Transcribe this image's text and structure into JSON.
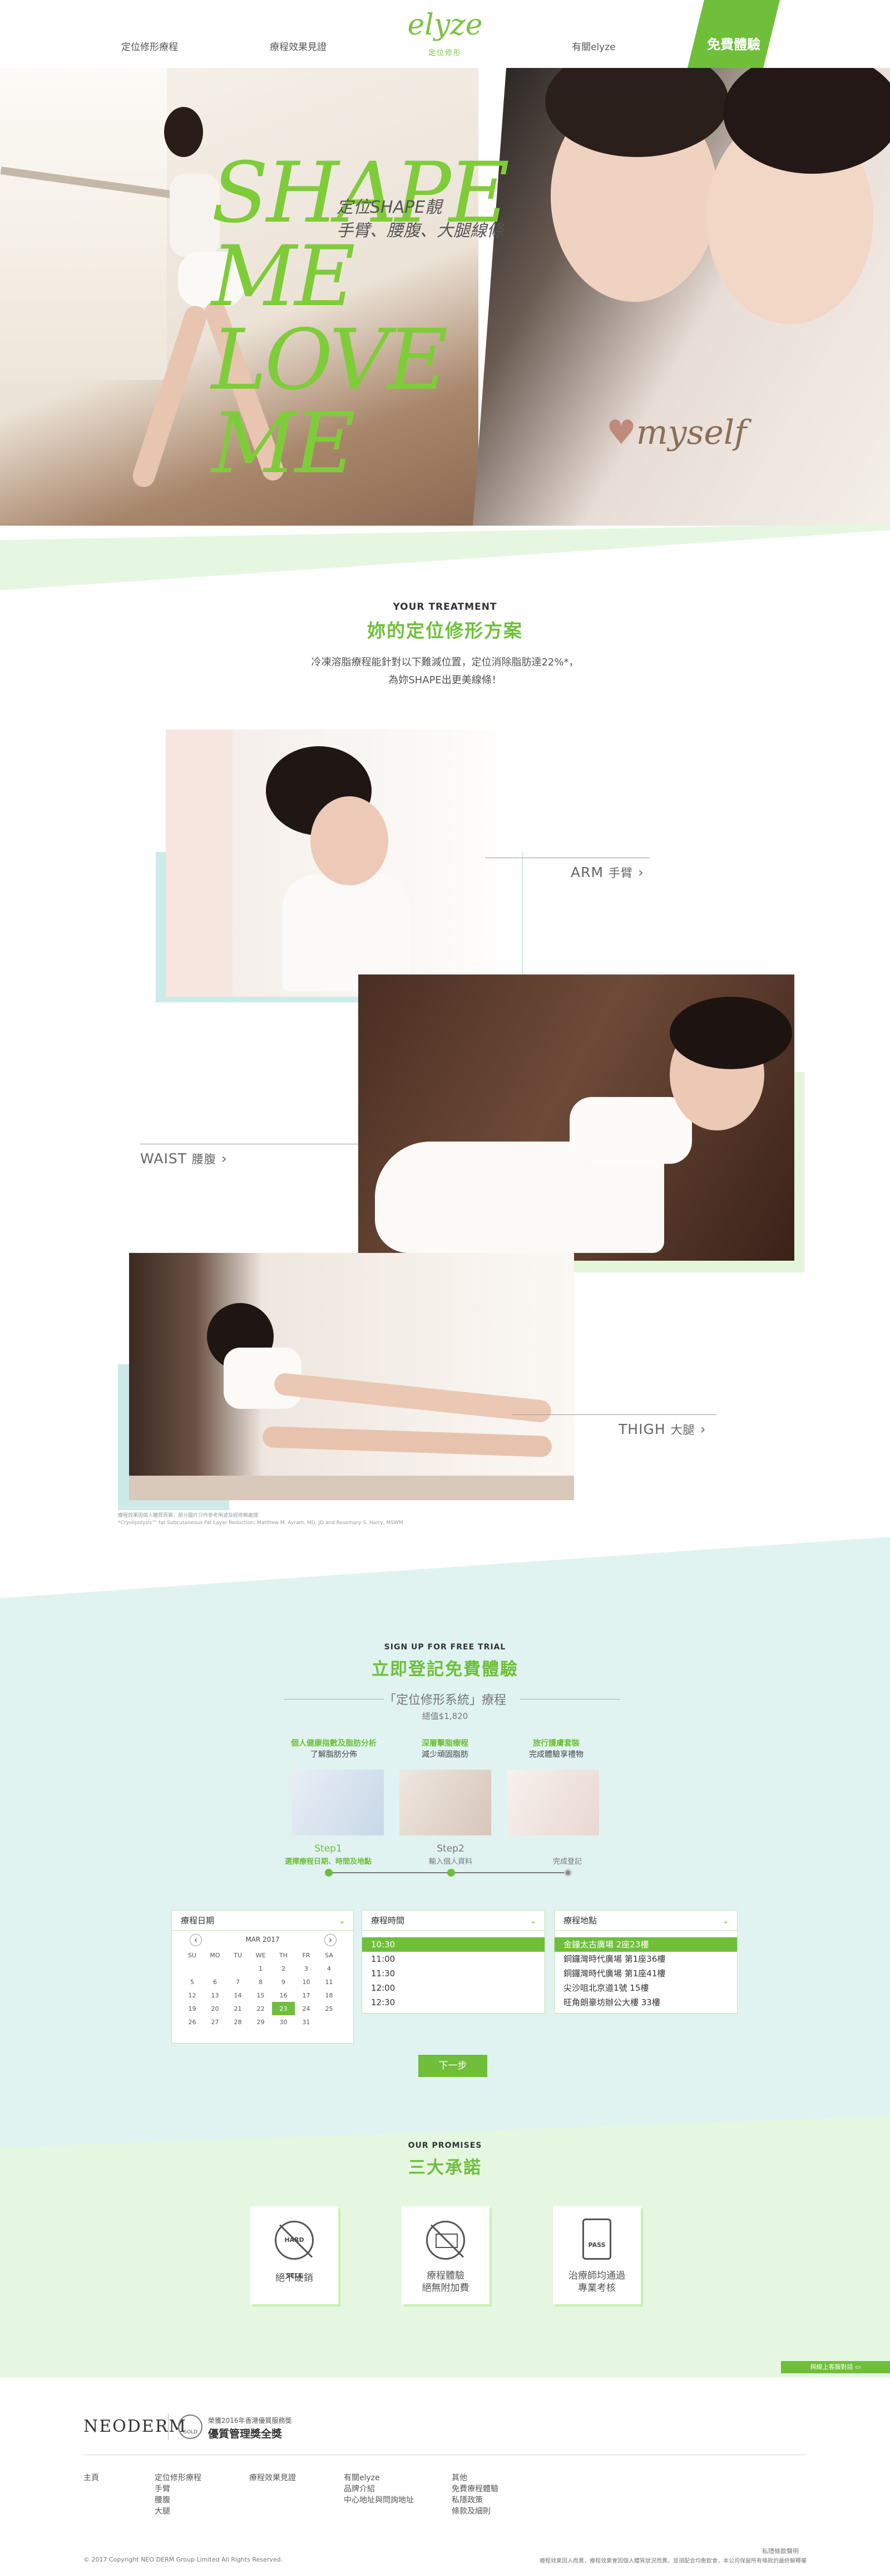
{
  "nav": {
    "item1": "定位修形療程",
    "item2": "療程效果見證",
    "item3": "有關elyze",
    "logo": "elyze",
    "logo_sub": "定位修形",
    "cta": "免費體驗"
  },
  "hero": {
    "headline": [
      "SHAPE",
      "ME",
      "LOVE",
      "ME"
    ],
    "sub1": "定位SHAPE靚",
    "sub2": "手臂、腰腹、大腿線條",
    "script": "myself"
  },
  "treatment": {
    "en": "YOUR TREATMENT",
    "zh": "妳的定位修形方案",
    "desc1": "冷凍溶脂療程能針對以下難減位置，定位消除脂肪達22%*，",
    "desc2": "為妳SHAPE出更美線條！",
    "areas": [
      {
        "en": "ARM",
        "zh": "手臂"
      },
      {
        "en": "WAIST",
        "zh": "腰腹"
      },
      {
        "en": "THIGH",
        "zh": "大腿"
      }
    ],
    "note1": "療程效果因個人體質而異，部分圖片只作參考用途及經修飾處理",
    "note2": "*Cryolipolysis™ fat Subcutaneous Fat Layer Reduction; Matthew M. Avram, MD,  JD and Rosemary S. Harry, MSWM"
  },
  "trial": {
    "en": "SIGN UP FOR FREE TRIAL",
    "zh": "立即登記免費體驗",
    "pkg": "「定位修形系統」療程",
    "price": "總值$1,820",
    "items": [
      {
        "t": "個人健康指數及脂肪分析",
        "s": "了解脂肪分佈"
      },
      {
        "t": "深層擊脂療程",
        "s": "減少頑固脂肪"
      },
      {
        "t": "旅行護膚套裝",
        "s": "完成體驗享禮物"
      }
    ],
    "steps": [
      {
        "n": "Step1",
        "t": "選擇療程日期、時間及地點"
      },
      {
        "n": "Step2",
        "t": "輸入個人資料"
      },
      {
        "n": "",
        "t": "完成登記"
      }
    ],
    "date": {
      "h": "療程日期",
      "month": "MAR 2017",
      "days": [
        "SU",
        "MO",
        "TU",
        "WE",
        "TH",
        "FR",
        "SA"
      ],
      "weeks": [
        [
          "",
          "",
          "",
          "1",
          "2",
          "3",
          "4"
        ],
        [
          "5",
          "6",
          "7",
          "8",
          "9",
          "10",
          "11"
        ],
        [
          "12",
          "13",
          "14",
          "15",
          "16",
          "17",
          "18"
        ],
        [
          "19",
          "20",
          "21",
          "22",
          "23",
          "24",
          "25"
        ],
        [
          "26",
          "27",
          "28",
          "29",
          "30",
          "31",
          ""
        ]
      ]
    },
    "time": {
      "h": "療程時間",
      "opts": [
        "10:30",
        "11:00",
        "11:30",
        "12:00",
        "12:30"
      ]
    },
    "loc": {
      "h": "療程地點",
      "opts": [
        "金鐘太古廣場 2座23樓",
        "銅鑼灣時代廣場 第1座36樓",
        "銅鑼灣時代廣場 第1座41樓",
        "尖沙咀北京道1號 15樓",
        "旺角朗豪坊辦公大樓 33樓"
      ]
    },
    "next": "下一步"
  },
  "promises": {
    "en": "OUR PROMISES",
    "zh": "三大承諾",
    "items": [
      {
        "icon": "HARD SELL",
        "t": "絕不硬銷"
      },
      {
        "icon": "",
        "t": "療程體驗",
        "t2": "絕無附加費"
      },
      {
        "icon": "PASS",
        "t": "治療師均通過",
        "t2": "專業考核"
      }
    ],
    "contact": "與線上客服對話"
  },
  "footer": {
    "brand": "NEODERM",
    "award1": "榮獲2016年香港優質服務獎",
    "award2": "優質管理獎全獎",
    "gold": "GOLD",
    "home": "主頁",
    "col1": [
      "定位修形療程",
      "手臂",
      "腰腹",
      "大腿"
    ],
    "col2": [
      "療程效果見證"
    ],
    "col3": [
      "有關elyze",
      "品牌介紹",
      "中心地址與問詢地址"
    ],
    "col4": [
      "其他",
      "免費療程體驗",
      "私隱政策",
      "條款及細則"
    ],
    "copy": "© 2017 Copyright NEO DERM Group Limited All Rights Reserved.",
    "pp": "私隱條款聲明",
    "disc": "療程效果因人而異，療程效果會因個人體質狀況而異，並須配合均衡飲食，本公司保留所有條款的最終解釋權"
  }
}
